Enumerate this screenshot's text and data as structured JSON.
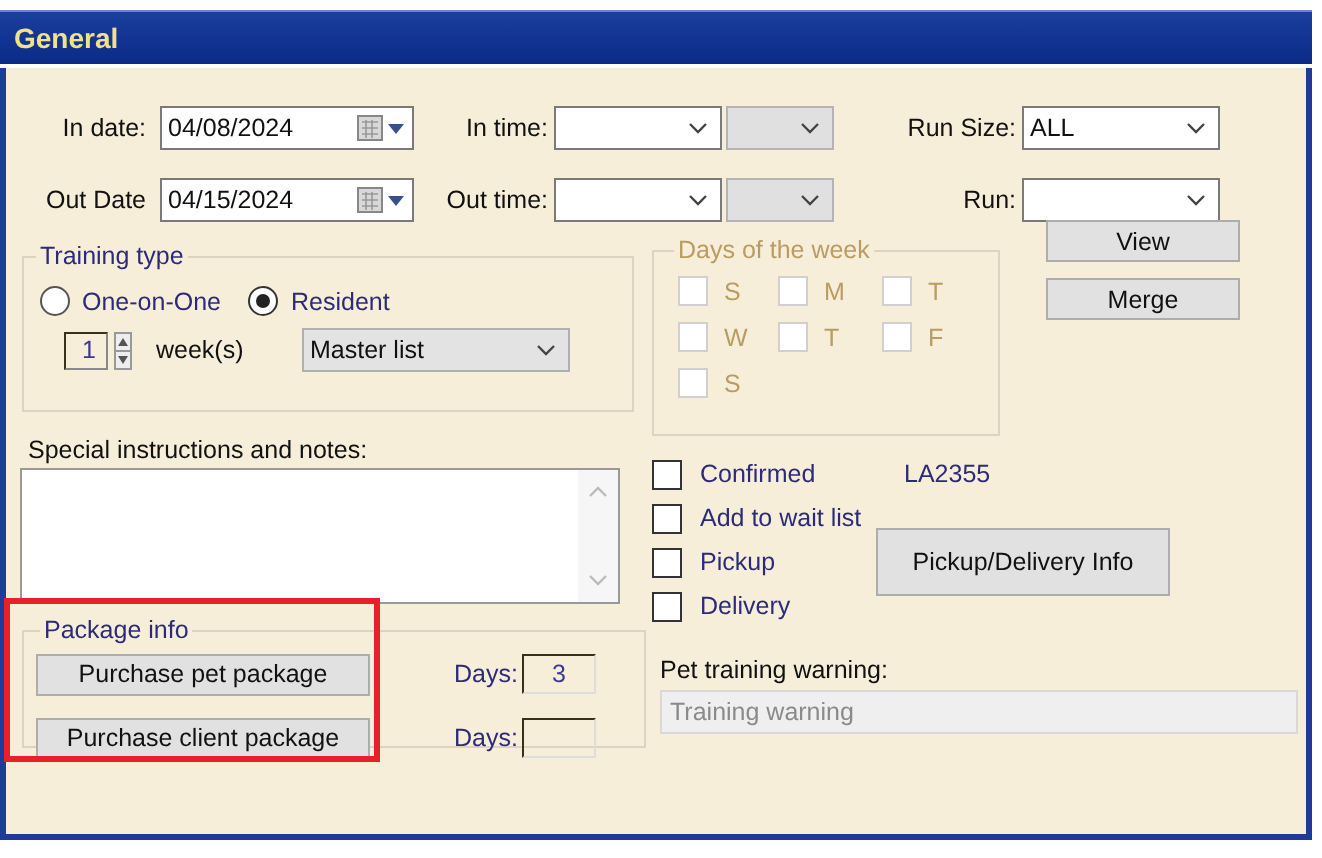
{
  "panel": {
    "title": "General"
  },
  "date_rows": [
    {
      "label": "In date:",
      "value": "04/08/2024",
      "time_label": "In time:",
      "time_fields": [
        {
          "disabled": false
        },
        {
          "disabled": true
        }
      ],
      "run_label": "Run Size:",
      "run_value": "ALL"
    },
    {
      "label": "Out Date",
      "value": "04/15/2024",
      "time_label": "Out time:",
      "time_fields": [
        {
          "disabled": false
        },
        {
          "disabled": true
        }
      ],
      "run_label": "Run:"
    }
  ],
  "run_buttons": [
    "View",
    "Merge"
  ],
  "training_type": {
    "title": "Training type",
    "options": [
      {
        "label": "One-on-One",
        "selected": false
      },
      {
        "label": "Resident",
        "selected": true
      }
    ],
    "weeks": {
      "value": "1",
      "unit": "week(s)"
    },
    "list": {
      "value": "Master list"
    }
  },
  "days_of_week": {
    "title": "Days of the week",
    "disabled": true,
    "days": [
      {
        "label": "S",
        "checked": false
      },
      {
        "label": "M",
        "checked": false
      },
      {
        "label": "T",
        "checked": false
      },
      {
        "label": "W",
        "checked": false
      },
      {
        "label": "T",
        "checked": false
      },
      {
        "label": "F",
        "checked": false
      },
      {
        "label": "S",
        "checked": false
      }
    ]
  },
  "notes": {
    "label": "Special instructions and notes:"
  },
  "options": [
    {
      "label": "Confirmed",
      "checked": false
    },
    {
      "label": "Add to wait list",
      "checked": false
    },
    {
      "label": "Pickup",
      "checked": false
    },
    {
      "label": "Delivery",
      "checked": false
    }
  ],
  "booking_code": "LA2355",
  "pickup_button": "Pickup/Delivery Info",
  "package_info": {
    "title": "Package info",
    "highlighted": true,
    "rows": [
      {
        "button": "Purchase pet package",
        "days_label": "Days:",
        "days": "3"
      },
      {
        "button": "Purchase client package",
        "days_label": "Days:"
      }
    ]
  },
  "training_warning": {
    "label": "Pet training warning:",
    "placeholder": "Training warning"
  }
}
